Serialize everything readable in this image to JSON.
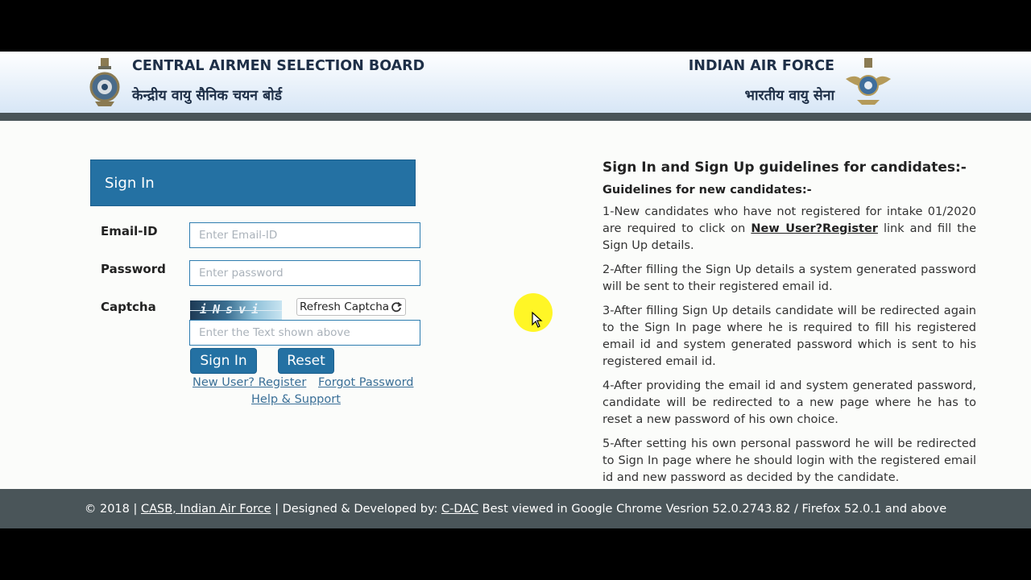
{
  "header": {
    "org_title_en": "CENTRAL AIRMEN SELECTION BOARD",
    "org_title_hi": "केन्द्रीय वायु सैनिक चयन बोर्ड",
    "force_title_en": "INDIAN AIR FORCE",
    "force_title_hi": "भारतीय वायु सेना"
  },
  "signin": {
    "heading": "Sign In",
    "email_label": "Email-ID",
    "email_placeholder": "Enter Email-ID",
    "email_value": "",
    "password_label": "Password",
    "password_placeholder": "Enter password",
    "password_value": "",
    "captcha_label": "Captcha",
    "captcha_text": "iNsvi",
    "refresh_label": "Refresh Captcha",
    "captcha_placeholder": "Enter the Text shown above",
    "captcha_value": "",
    "signin_button": "Sign In",
    "reset_button": "Reset",
    "register_link": "New User? Register",
    "forgot_link": "Forgot Password",
    "help_link": "Help & Support"
  },
  "guidelines": {
    "title": "Sign In and Sign Up guidelines for candidates:-",
    "subtitle": "Guidelines for new candidates:-",
    "p1_before": "1-New candidates who have not registered for intake 01/2020 are required to click on ",
    "p1_link": "New User?Register",
    "p1_after": " link and fill the Sign Up details.",
    "p2": "2-After filling the Sign Up details a system generated password will be sent to their registered email id.",
    "p3": "3-After filling Sign Up details candidate will be redirected again to the Sign In page where he is required to fill his registered email id and system generated password which is sent to his registered email id.",
    "p4": "4-After providing the email id and system generated password, candidate will be redirected to a new page where he has to reset a new password of his own choice.",
    "p5": "5-After setting his own personal password he will be redirected to Sign In page where he should login with the registered email id and new password as decided by the candidate."
  },
  "footer": {
    "copyright": "© 2018 |",
    "casb_link": "CASB, Indian Air Force",
    "designed_by": "| Designed & Developed by:",
    "cdac_link": "C-DAC",
    "best_viewed": "Best viewed in Google Chrome Vesrion 52.0.2743.82 / Firefox 52.0.1 and above"
  },
  "icons": {
    "left_emblem": "casb-emblem-icon",
    "right_emblem": "iaf-emblem-icon",
    "refresh": "refresh-icon",
    "cursor": "mouse-cursor-icon"
  },
  "colors": {
    "primary": "#2471a3",
    "header_bar": "#4a5559",
    "link": "#3a6f97"
  }
}
